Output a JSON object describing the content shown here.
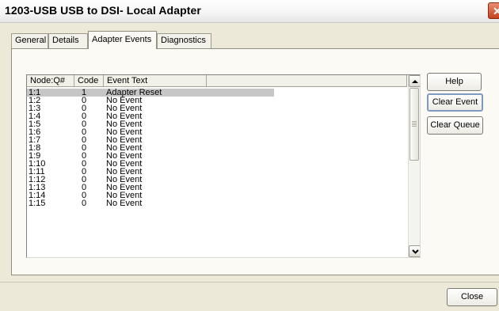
{
  "window": {
    "title": "1203-USB  USB to DSI- Local Adapter",
    "close_glyph": "✕"
  },
  "tabs": [
    {
      "label": "General"
    },
    {
      "label": "Details"
    },
    {
      "label": "Adapter Events"
    },
    {
      "label": "Diagnostics"
    }
  ],
  "active_tab": "Adapter Events",
  "events_table": {
    "columns": [
      "Node:Q#",
      "Code",
      "Event Text"
    ],
    "rows": [
      {
        "node": "1:1",
        "code": "1",
        "text": "Adapter Reset"
      },
      {
        "node": "1:2",
        "code": "0",
        "text": "No Event"
      },
      {
        "node": "1:3",
        "code": "0",
        "text": "No Event"
      },
      {
        "node": "1:4",
        "code": "0",
        "text": "No Event"
      },
      {
        "node": "1:5",
        "code": "0",
        "text": "No Event"
      },
      {
        "node": "1:6",
        "code": "0",
        "text": "No Event"
      },
      {
        "node": "1:7",
        "code": "0",
        "text": "No Event"
      },
      {
        "node": "1:8",
        "code": "0",
        "text": "No Event"
      },
      {
        "node": "1:9",
        "code": "0",
        "text": "No Event"
      },
      {
        "node": "1:10",
        "code": "0",
        "text": "No Event"
      },
      {
        "node": "1:11",
        "code": "0",
        "text": "No Event"
      },
      {
        "node": "1:12",
        "code": "0",
        "text": "No Event"
      },
      {
        "node": "1:13",
        "code": "0",
        "text": "No Event"
      },
      {
        "node": "1:14",
        "code": "0",
        "text": "No Event"
      },
      {
        "node": "1:15",
        "code": "0",
        "text": "No Event"
      }
    ],
    "selected_row": 0
  },
  "side_buttons": {
    "help": "Help",
    "clear_event": "Clear Event",
    "clear_queue": "Clear Queue"
  },
  "footer": {
    "close": "Close"
  },
  "colors": {
    "selection": "#c6c6c6",
    "face": "#ece9d8",
    "close_button": "#c4411e"
  },
  "icons": {
    "scroll_up": "triangle-up-icon",
    "scroll_down": "chevron-down-icon"
  }
}
